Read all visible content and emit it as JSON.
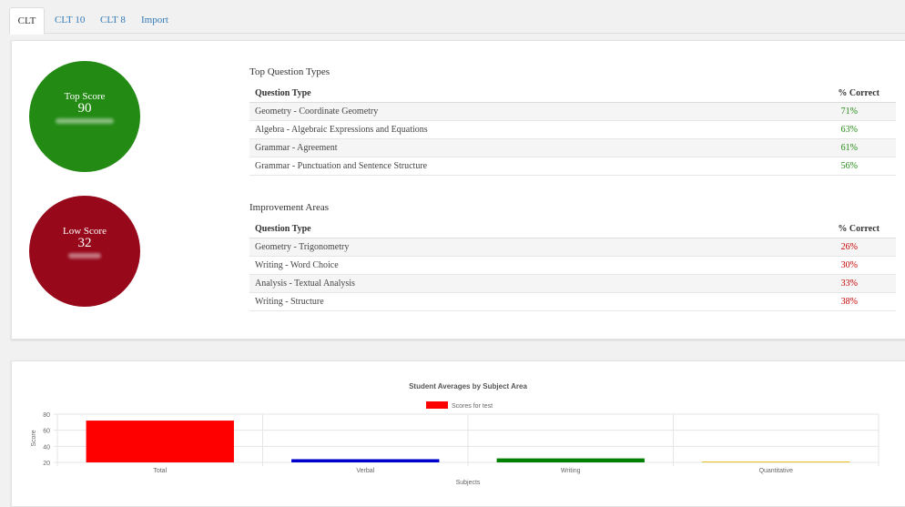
{
  "tabs": [
    {
      "label": "CLT",
      "active": true
    },
    {
      "label": "CLT 10",
      "active": false
    },
    {
      "label": "CLT 8",
      "active": false
    },
    {
      "label": "Import",
      "active": false
    }
  ],
  "top_score": {
    "label": "Top Score",
    "value": "90",
    "color": "#238a14"
  },
  "low_score": {
    "label": "Low Score",
    "value": "32",
    "color": "#96081a"
  },
  "top_types": {
    "title": "Top Question Types",
    "col_type": "Question Type",
    "col_pct": "% Correct",
    "rows": [
      {
        "type": "Geometry - Coordinate Geometry",
        "pct": "71%"
      },
      {
        "type": "Algebra - Algebraic Expressions and Equations",
        "pct": "63%"
      },
      {
        "type": "Grammar - Agreement",
        "pct": "61%"
      },
      {
        "type": "Grammar - Punctuation and Sentence Structure",
        "pct": "56%"
      }
    ]
  },
  "improvement": {
    "title": "Improvement Areas",
    "col_type": "Question Type",
    "col_pct": "% Correct",
    "rows": [
      {
        "type": "Geometry - Trigonometry",
        "pct": "26%"
      },
      {
        "type": "Writing - Word Choice",
        "pct": "30%"
      },
      {
        "type": "Analysis - Textual Analysis",
        "pct": "33%"
      },
      {
        "type": "Writing - Structure",
        "pct": "38%"
      }
    ]
  },
  "chart_data": {
    "type": "bar",
    "title": "Student Averages by Subject Area",
    "legend_position": "top",
    "categories": [
      "Total",
      "Verbal",
      "Writing",
      "Quantitative"
    ],
    "series": [
      {
        "name": "Scores for test",
        "values": [
          72,
          24,
          25,
          21
        ]
      }
    ],
    "bar_colors": [
      "#ff0000",
      "#0000cc",
      "#008000",
      "#e6b800"
    ],
    "legend_color": "#ff0000",
    "xlabel": "Subjects",
    "ylabel": "Score",
    "yticks": [
      "80",
      "60",
      "40",
      "20"
    ],
    "ylim": [
      20,
      80
    ],
    "grid": true
  }
}
